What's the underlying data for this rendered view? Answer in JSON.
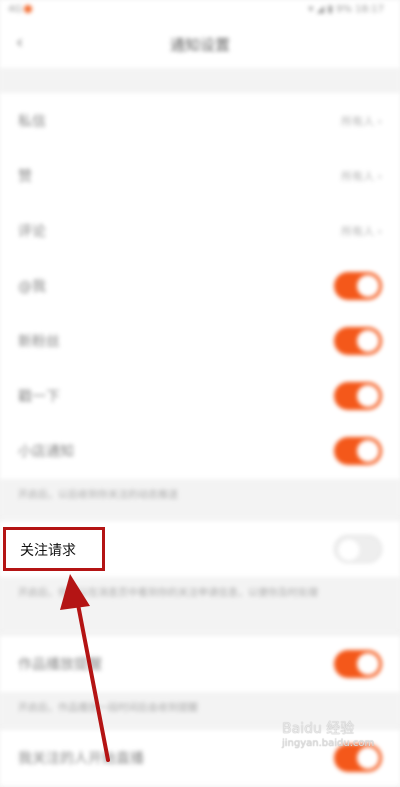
{
  "status_bar": {
    "left": "4G",
    "right": "▾ ◢ ▮ 9% 18:17"
  },
  "nav": {
    "title": "通知设置"
  },
  "top_hint": "",
  "rows": {
    "private_msg": {
      "label": "私信",
      "value": "所有人 ›"
    },
    "like": {
      "label": "赞",
      "value": "所有人 ›"
    },
    "comment": {
      "label": "评论",
      "value": "所有人 ›"
    },
    "mention": {
      "label": "@我"
    },
    "new_fans": {
      "label": "新粉丝"
    },
    "poke": {
      "label": "戳一下"
    },
    "notice": {
      "label": "小店通知"
    }
  },
  "note1": "开启后，以后收到你关注的动态推送",
  "follow_request": {
    "label": "关注请求",
    "enabled": false
  },
  "note2": "开启后，你可以在消息页中看到你的关注申请信息，以便你及时处理",
  "works": {
    "label": "作品播放提醒"
  },
  "note3": "开启后，作品播放一段时间后会收到提醒",
  "bottom": {
    "label": "我关注的人开始直播"
  },
  "toggles": {
    "mention": true,
    "new_fans": true,
    "poke": true,
    "notice": true,
    "follow_request": false,
    "works": true,
    "bottom": true
  },
  "watermark": {
    "brand": "Baidu 经验",
    "sub": "jingyan.baidu.com"
  }
}
